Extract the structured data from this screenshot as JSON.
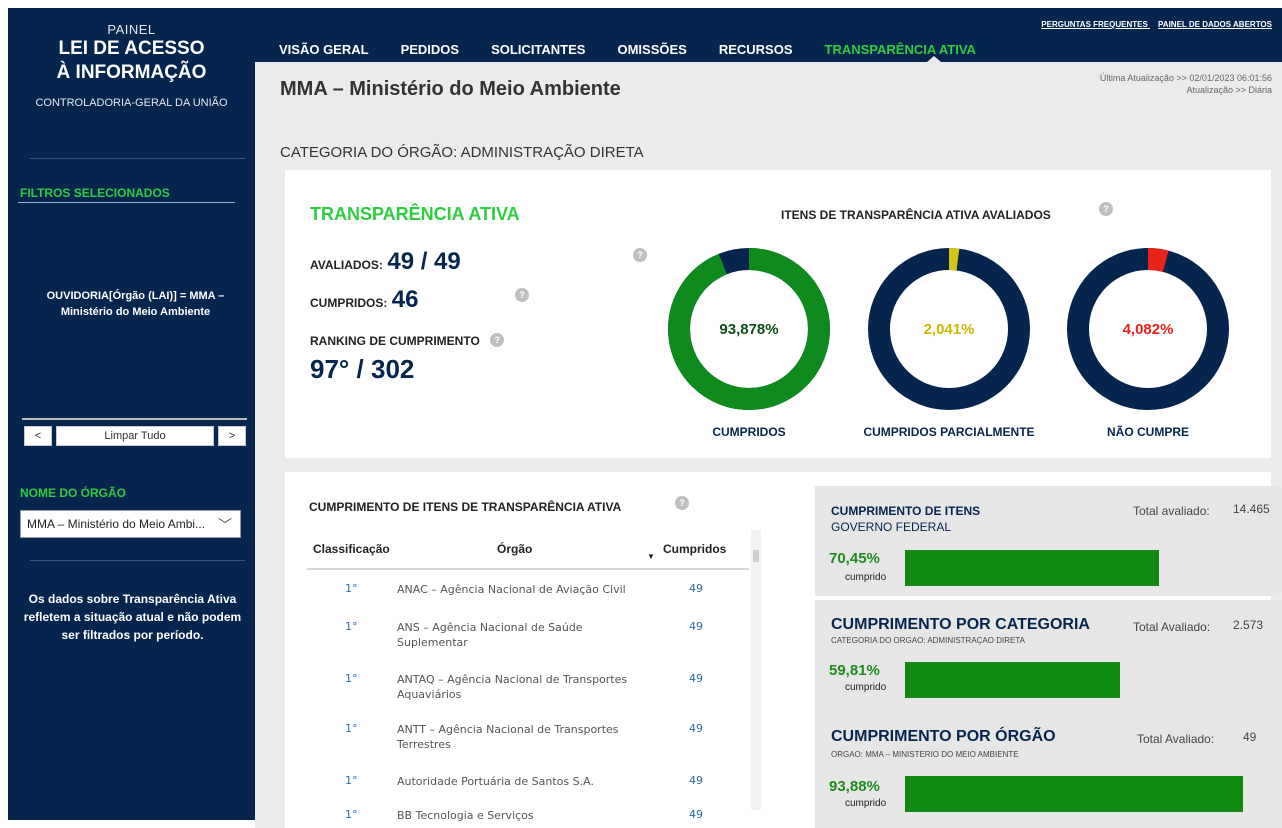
{
  "sidebar": {
    "brand_small": "PAINEL",
    "brand_line1": "LEI DE ACESSO",
    "brand_line2": "À INFORMAÇÃO",
    "brand_sub": "CONTROLADORIA-GERAL DA UNIÃO",
    "filters_title": "FILTROS SELECIONADOS",
    "filter_text": "OUVIDORIA[Órgão (LAI)] = MMA – Ministério do Meio Ambiente",
    "prev_label": "<",
    "clear_label": "Limpar Tudo",
    "next_label": ">",
    "org_title": "NOME DO ÓRGÃO",
    "org_select_value": "MMA – Ministério do Meio Ambi...",
    "note": "Os dados sobre Transparência Ativa refletem a situação atual e não podem ser filtrados por período."
  },
  "header": {
    "link_faq": "PERGUNTAS FREQUENTES",
    "link_open_data": "PAINEL DE DADOS ABERTOS",
    "tabs": [
      {
        "label": "VISÃO GERAL"
      },
      {
        "label": "PEDIDOS"
      },
      {
        "label": "SOLICITANTES"
      },
      {
        "label": "OMISSÕES"
      },
      {
        "label": "RECURSOS"
      },
      {
        "label": "TRANSPARÊNCIA ATIVA"
      }
    ]
  },
  "main": {
    "org_title": "MMA – Ministério do Meio Ambiente",
    "update_line1": "Última Atualização >> 02/01/2023 06:01:56",
    "update_line2": "Atualização >> Diária",
    "category": "CATEGORIA DO ÓRGÃO: ADMINISTRAÇÃO DIRETA"
  },
  "summary": {
    "title": "TRANSPARÊNCIA ATIVA",
    "evaluated_label": "AVALIADOS:",
    "evaluated_value": "49 / 49",
    "fulfilled_label": "CUMPRIDOS:",
    "fulfilled_value": "46",
    "ranking_label": "RANKING DE CUMPRIMENTO",
    "ranking_value": "97° / 302",
    "items_title": "ITENS DE TRANSPARÊNCIA ATIVA AVALIADOS"
  },
  "donuts": [
    {
      "label": "CUMPRIDOS",
      "pct_text": "93,878%",
      "fraction": 0.93878,
      "color": "#0f8a1c",
      "text_color": "#0f4d1a"
    },
    {
      "label": "CUMPRIDOS PARCIALMENTE",
      "pct_text": "2,041%",
      "fraction": 0.02041,
      "color": "#d4c41a",
      "text_color": "#c9b800"
    },
    {
      "label": "NÃO CUMPRE",
      "pct_text": "4,082%",
      "fraction": 0.04082,
      "color": "#e8231a",
      "text_color": "#e8231a"
    }
  ],
  "table": {
    "title": "CUMPRIMENTO DE ITENS DE TRANSPARÊNCIA ATIVA",
    "col_rank": "Classificação",
    "col_org": "Órgão",
    "col_value": "Cumpridos",
    "rows": [
      {
        "rank": "1°",
        "org": "ANAC – Agência Nacional de Aviação Civil",
        "value": "49"
      },
      {
        "rank": "1°",
        "org": "ANS – Agência Nacional de Saúde Suplementar",
        "value": "49"
      },
      {
        "rank": "1°",
        "org": "ANTAQ – Agência Nacional de Transportes Aquaviários",
        "value": "49"
      },
      {
        "rank": "1°",
        "org": "ANTT – Agência Nacional de Transportes Terrestres",
        "value": "49"
      },
      {
        "rank": "1°",
        "org": "Autoridade Portuária de Santos S.A.",
        "value": "49"
      },
      {
        "rank": "1°",
        "org": "BB Tecnologia e Serviços",
        "value": "49"
      }
    ]
  },
  "metrics": [
    {
      "title": "CUMPRIMENTO DE ITENS",
      "subtitle": "GOVERNO FEDERAL",
      "total_label": "Total avaliado:",
      "total_value": "14.465",
      "pct": "70,45%",
      "caption": "cumprido",
      "fraction": 0.7045
    },
    {
      "title": "CUMPRIMENTO POR CATEGORIA",
      "subtitle": "CATEGORIA DO ORGAO: ADMINISTRAÇAO DIRETA",
      "total_label": "Total Avaliado:",
      "total_value": "2.573",
      "pct": "59,81%",
      "caption": "cumprido",
      "fraction": 0.5981
    },
    {
      "title": "CUMPRIMENTO POR ÓRGÃO",
      "subtitle": "ORGAO: MMA – MINISTERIO DO MEIO AMBIENTE",
      "total_label": "Total Avaliado:",
      "total_value": "49",
      "pct": "93,88%",
      "caption": "cumprido",
      "fraction": 0.9388
    }
  ]
}
